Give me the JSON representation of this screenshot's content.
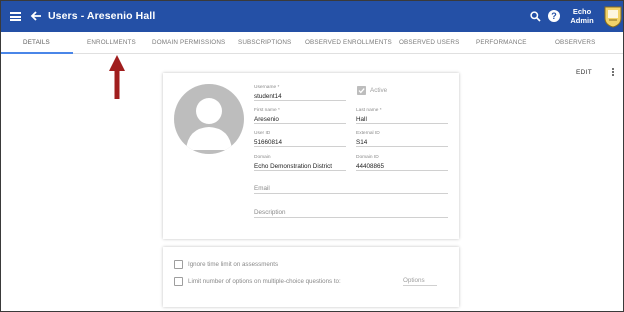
{
  "colors": {
    "appbar": "#2450a6",
    "tab_indicator": "#4a86e8",
    "arrow": "#a01e1e"
  },
  "header": {
    "title": "Users - Aresenio Hall",
    "user_line1": "Echo",
    "user_line2": "Admin"
  },
  "tabs": [
    {
      "label": "DETAILS",
      "active": true
    },
    {
      "label": "ENROLLMENTS"
    },
    {
      "label": "DOMAIN PERMISSIONS"
    },
    {
      "label": "SUBSCRIPTIONS"
    },
    {
      "label": "OBSERVED ENROLLMENTS"
    },
    {
      "label": "OBSERVED USERS"
    },
    {
      "label": "PERFORMANCE"
    },
    {
      "label": "OBSERVERS"
    }
  ],
  "toolbar": {
    "edit_label": "EDIT"
  },
  "profile": {
    "username_label": "Username *",
    "username": "student14",
    "active_label": "Active",
    "first_name_label": "First name *",
    "first_name": "Aresenio",
    "last_name_label": "Last name *",
    "last_name": "Hall",
    "user_id_label": "User ID",
    "user_id": "51660814",
    "external_id_label": "External ID",
    "external_id": "S14",
    "domain_label": "Domain",
    "domain": "Echo Demonstration District",
    "domain_id_label": "Domain ID",
    "domain_id": "44408865",
    "email_placeholder": "Email",
    "description_placeholder": "Description"
  },
  "settings": {
    "ignore_time_limit_label": "Ignore time limit on assessments",
    "limit_options_label": "Limit number of options on multiple-choice questions to:",
    "options_placeholder": "Options"
  },
  "icons": [
    "menu-icon",
    "back-arrow-icon",
    "search-icon",
    "help-icon",
    "app-logo-icon",
    "more-vert-icon",
    "avatar-placeholder-icon",
    "annotation-arrow"
  ]
}
